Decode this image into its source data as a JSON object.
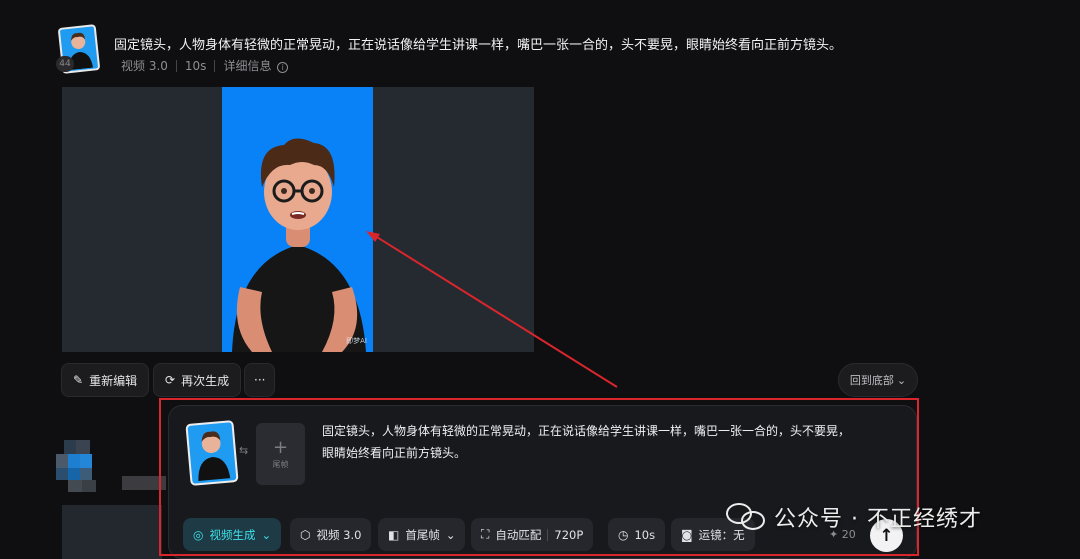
{
  "task": {
    "prompt": "固定镜头，人物身体有轻微的正常晃动，正在说话像给学生讲课一样，嘴巴一张一合的，头不要晃，眼睛始终看向正前方镜头。",
    "badge": "44",
    "model": "视频 3.0",
    "duration": "10s",
    "details_label": "详细信息"
  },
  "video": {
    "watermark": "即梦AI"
  },
  "actions": {
    "reedit": "重新编辑",
    "regenerate": "再次生成",
    "more": "···",
    "back_to_bottom": "回到底部"
  },
  "composer": {
    "end_frame_label": "尾帧",
    "prompt_line1": "固定镜头，人物身体有轻微的正常晃动，正在说话像给学生讲课一样，嘴巴一张一合的，头不要晃，",
    "prompt_line2": "眼睛始终看向正前方镜头。",
    "mode": "视频生成",
    "model": "视频 3.0",
    "frames": "首尾帧",
    "ratio": "自动匹配",
    "resolution": "720P",
    "duration": "10s",
    "camera": "运镜：无",
    "credits": "20"
  },
  "watermark_overlay": {
    "text": "公众号 · 不正经绣才"
  },
  "colors": {
    "accent": "#3ee0e8",
    "video_bg": "#0a82f7",
    "highlight": "#d9262c"
  }
}
